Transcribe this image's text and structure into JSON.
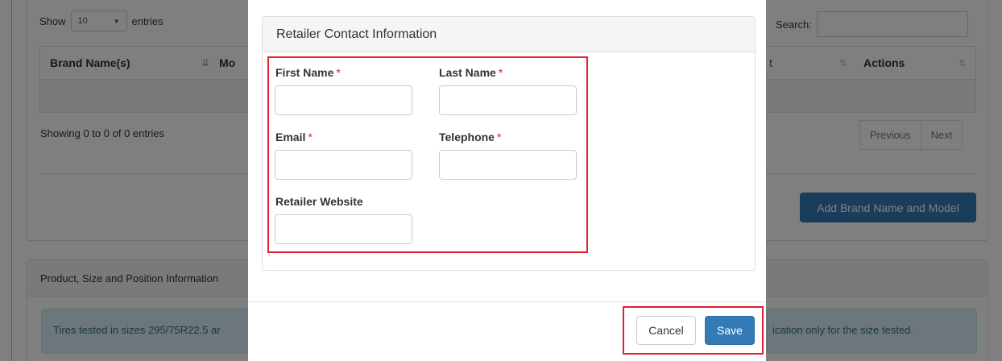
{
  "background": {
    "table_controls": {
      "show_label": "Show",
      "entries_value": "10",
      "entries_label": "entries",
      "search_label": "Search:"
    },
    "table": {
      "columns": [
        {
          "label": "Brand Name(s)"
        },
        {
          "label": "Mo"
        },
        {
          "label": "t"
        },
        {
          "label": "Actions"
        }
      ],
      "info": "Showing 0 to 0 of 0 entries",
      "pagination": {
        "previous": "Previous",
        "next": "Next"
      }
    },
    "add_button_label": "Add Brand Name and Model",
    "product_panel": {
      "heading": "Product, Size and Position Information",
      "alert_left": "Tires tested in sizes 295/75R22.5 ar",
      "alert_right": "ication only for the size tested."
    }
  },
  "modal": {
    "panel_title": "Retailer Contact Information",
    "fields": {
      "first_name": {
        "label": "First Name",
        "required": "*",
        "value": ""
      },
      "last_name": {
        "label": "Last Name",
        "required": "*",
        "value": ""
      },
      "email": {
        "label": "Email",
        "required": "*",
        "value": ""
      },
      "telephone": {
        "label": "Telephone",
        "required": "*",
        "value": ""
      },
      "website": {
        "label": "Retailer Website",
        "value": ""
      }
    },
    "buttons": {
      "cancel": "Cancel",
      "save": "Save"
    }
  },
  "colors": {
    "primary": "#337ab7",
    "highlight_border": "#e0202e",
    "required_asterisk": "#e0202e",
    "info_alert_bg": "#d9edf7",
    "info_alert_text": "#31708f",
    "backdrop": "rgba(0,0,0,0.5)"
  },
  "icons": [
    "sort-asc-icon",
    "sort-icon",
    "caret-down-icon"
  ]
}
